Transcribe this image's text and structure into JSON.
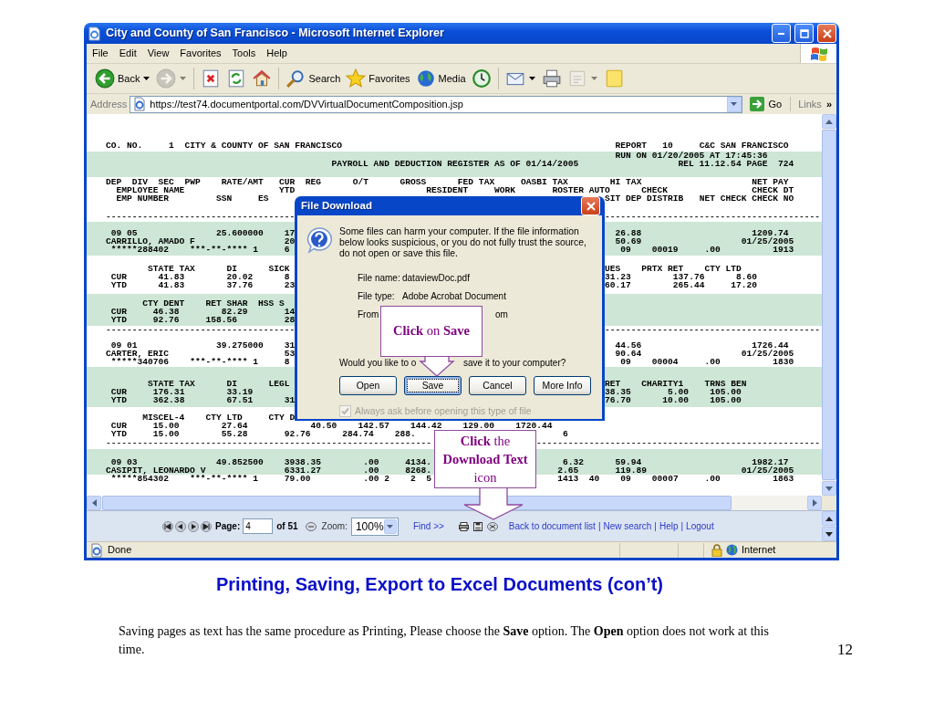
{
  "window": {
    "title": "City and County of San Francisco - Microsoft Internet Explorer"
  },
  "menu": [
    "File",
    "Edit",
    "View",
    "Favorites",
    "Tools",
    "Help"
  ],
  "toolbar": [
    [
      {
        "kind": "back",
        "label": "Back",
        "dropdown": true,
        "disabled": false
      },
      {
        "kind": "forward",
        "dropdown": true,
        "disabled": true
      }
    ],
    [
      {
        "kind": "stop",
        "dropdown": false,
        "disabled": false
      },
      {
        "kind": "refresh",
        "dropdown": false,
        "disabled": false
      },
      {
        "kind": "home",
        "dropdown": false,
        "disabled": false
      }
    ],
    [
      {
        "kind": "search",
        "label": "Search",
        "dropdown": false,
        "disabled": false
      },
      {
        "kind": "favorites",
        "label": "Favorites",
        "dropdown": false,
        "disabled": false
      },
      {
        "kind": "media",
        "label": "Media",
        "dropdown": false,
        "disabled": false
      },
      {
        "kind": "history",
        "dropdown": false,
        "disabled": false
      }
    ],
    [
      {
        "kind": "mail",
        "dropdown": true,
        "disabled": false
      },
      {
        "kind": "print",
        "dropdown": false,
        "disabled": false
      },
      {
        "kind": "edit",
        "dropdown": true,
        "disabled": true
      },
      {
        "kind": "note",
        "dropdown": false,
        "disabled": false
      }
    ]
  ],
  "address": {
    "label": "Address",
    "url": "https://test74.documentportal.com/DVVirtualDocumentComposition.jsp",
    "go": "Go",
    "links": "Links",
    "more": "»"
  },
  "report": {
    "bands": [
      {
        "color": "#ffffff",
        "kind": "lines",
        "lines": [
          "CO. NO.     1  CITY & COUNTY OF SAN FRANCISCO                                                    REPORT   10     C&C SAN FRANCISCO"
        ]
      },
      {
        "color": "#cde6d6",
        "kind": "lines",
        "lines": [
          "                                                                                                 RUN ON 01/20/2005 AT 17:45:36",
          "                                           PAYROLL AND DEDUCTION REGISTER AS OF 01/14/2005                   REL 11.12.54 PAGE  724"
        ]
      },
      {
        "color": "#ffffff",
        "kind": "lines",
        "lines": [
          "DEP  DIV  SEC  PWP    RATE/AMT   CUR  REG      O/T      GROSS      FED TAX     OASBI TAX        HI TAX                     NET PAY",
          "  EMPLOYEE NAME                  YTD                         RESIDENT     WORK       ROSTER AUTO      CHECK                CHECK DT",
          "  EMP NUMBER         SSN     ES                                                                SIT DEP DISTRIB   NET CHECK CHECK NO"
        ]
      },
      {
        "color": "#ffffff",
        "kind": "rule",
        "lines": [
          "------------------------------------                                                           -----------------------------------------"
        ]
      },
      {
        "color": "#cde6d6",
        "kind": "lines",
        "lines": [
          " 09 05               25.600000    17                                                             26.88                     1209.74",
          "CARRILLO, AMADO F                 20                                                             50.69                   01/25/2005",
          " *****288402    ***-**-**** 1     6                                                               09    00019     .00          1913"
        ]
      },
      {
        "color": "#ffffff",
        "kind": "lines",
        "lines": [
          "        STATE TAX      DI      SICK                                                            UES    PRTX RET    CTY LTD",
          " CUR      41.83        20.02      8                                                            31.23        137.76      8.60",
          " YTD      41.83        37.76      23                                                           60.17        265.44     17.20"
        ]
      },
      {
        "color": "#cde6d6",
        "kind": "lines",
        "lines": [
          "       CTY DENT    RET SHAR  HSS S",
          " CUR     46.38        82.29       14",
          " YTD     92.76     158.56         28"
        ]
      },
      {
        "color": "#ffffff",
        "kind": "rule",
        "lines": [
          "------------------------------------                                                           -----------------------------------------"
        ]
      },
      {
        "color": "#ffffff",
        "kind": "lines",
        "lines": [
          " 09 01               39.275000    31                                                             44.56                     1726.44",
          "CARTER, ERIC                      53                                                             90.64                   01/25/2005",
          " *****340706    ***-**-**** 1     8                                                               09    00004     .00          1830"
        ]
      },
      {
        "color": "#cde6d6",
        "kind": "lines",
        "lines": [
          "        STATE TAX      DI      LEGL                                                            RET    CHARITY1    TRNS BEN",
          " CUR     176.31        33.19                                                                   38.35       5.00    105.00",
          " YTD     362.38        67.51      31                                                           76.70      10.00    105.00"
        ]
      },
      {
        "color": "#ffffff",
        "kind": "lines",
        "lines": [
          "       MISCEL-4    CTY LTD     CTY D",
          " CUR     15.00        27.64            40.50    142.57    144.42    129.00    1720.44",
          " YTD     15.00        55.28       92.76      284.74    288.                            6"
        ]
      },
      {
        "color": "#ffffff",
        "kind": "rule",
        "lines": [
          "--------------------------------------------------------------                    ------------------------------------------------------"
        ]
      },
      {
        "color": "#cde6d6",
        "kind": "lines",
        "lines": [
          " 09 03               49.852500    3938.35        .00     4134.                         6.32      59.94                     1982.17",
          "CASIPIT, LEONARDO V               6331.27        .00     8268.                        2.65       119.89                  01/25/2005"
        ]
      },
      {
        "color": "#ffffff",
        "kind": "lines",
        "lines": [
          " *****854302    ***-**-**** 1     79.00          .00 2    2  5                        1413  40    09    00007     .00          1863"
        ]
      }
    ]
  },
  "dialog": {
    "title": "File Download",
    "message": "Some files can harm your computer. If the file information below looks suspicious, or you do not fully trust the source, do not open or save this file.",
    "fields": [
      {
        "label": "File name:",
        "value": "dataviewDoc.pdf",
        "kind": "full"
      },
      {
        "label": "File type:",
        "value": "Adobe Acrobat Document",
        "kind": "full"
      },
      {
        "label": "From",
        "value": "om",
        "kind": "partial"
      }
    ],
    "question": [
      "Would you like to o",
      "save it to your computer?"
    ],
    "buttons": [
      {
        "label": "Open",
        "focused": false
      },
      {
        "label": "Save",
        "focused": true
      },
      {
        "label": "Cancel",
        "focused": false
      },
      {
        "label": "More Info",
        "focused": false
      }
    ],
    "checkbox": {
      "label": "Always ask before opening this type of file",
      "checked": true,
      "disabled": true
    }
  },
  "callouts": [
    {
      "text": "**Click** on **Save**"
    },
    {
      "text": "**Click** the **Download Text** icon"
    }
  ],
  "viewer": {
    "page_label": "Page:",
    "page": "4",
    "of": "of 51",
    "zoom_label": "Zoom:",
    "zoom": "100%",
    "find": "Find >>",
    "links": [
      "Back to document list",
      "New search",
      "Help",
      "Logout"
    ],
    "separator": "|"
  },
  "status": {
    "text": "Done",
    "zone": "Internet"
  },
  "slide": {
    "heading": "Printing, Saving, Export to Excel Documents (con’t)",
    "body": "Saving pages as text has the same procedure as Printing,  Please choose the **Save** option.  The **Open** option does not work at this time.",
    "page_number": "12"
  }
}
